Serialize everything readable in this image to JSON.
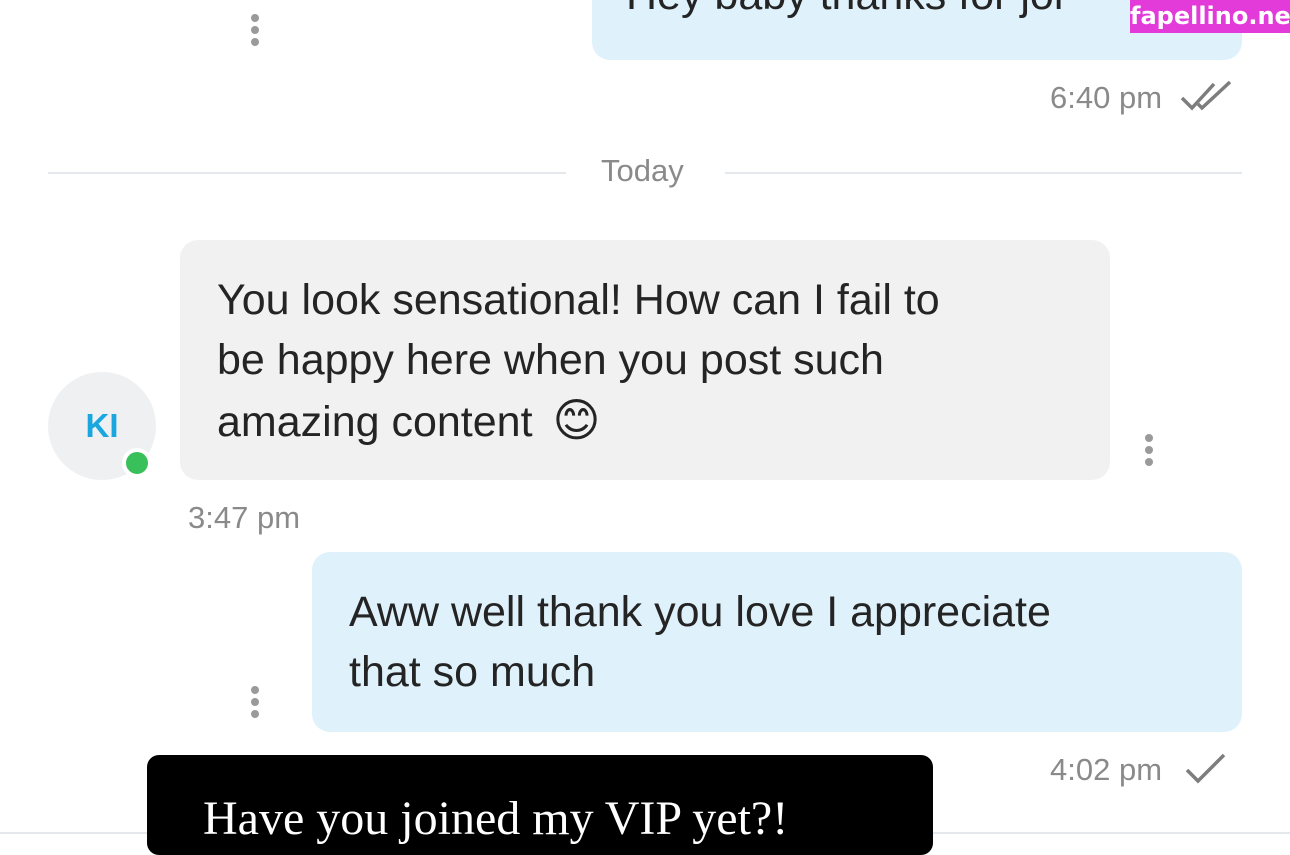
{
  "watermark": "fapellino.net",
  "messages": [
    {
      "text": "Hey baby thanks for joi",
      "time": "6:40 pm",
      "status": "read"
    },
    {
      "text_lines": [
        "You look sensational! How can I fail to",
        "be happy here when you post such",
        "amazing content"
      ],
      "emoji": "😊",
      "time": "3:47 pm"
    },
    {
      "text_lines": [
        "Aww well thank you love I appreciate",
        "that so much"
      ],
      "time": "4:02 pm",
      "status": "sent"
    }
  ],
  "divider": {
    "label": "Today"
  },
  "sender": {
    "initials": "KI",
    "online": true,
    "avatar_color": "#1aa7e0",
    "online_color": "#3ac05a"
  },
  "overlay": {
    "text": "Have you joined my VIP yet?!"
  },
  "colors": {
    "outgoing_bubble": "#dff2fb",
    "incoming_bubble": "#f1f1f1",
    "watermark_bg": "#e23bd9"
  },
  "icons": [
    "more-vertical-icon",
    "double-check-icon",
    "check-icon"
  ]
}
